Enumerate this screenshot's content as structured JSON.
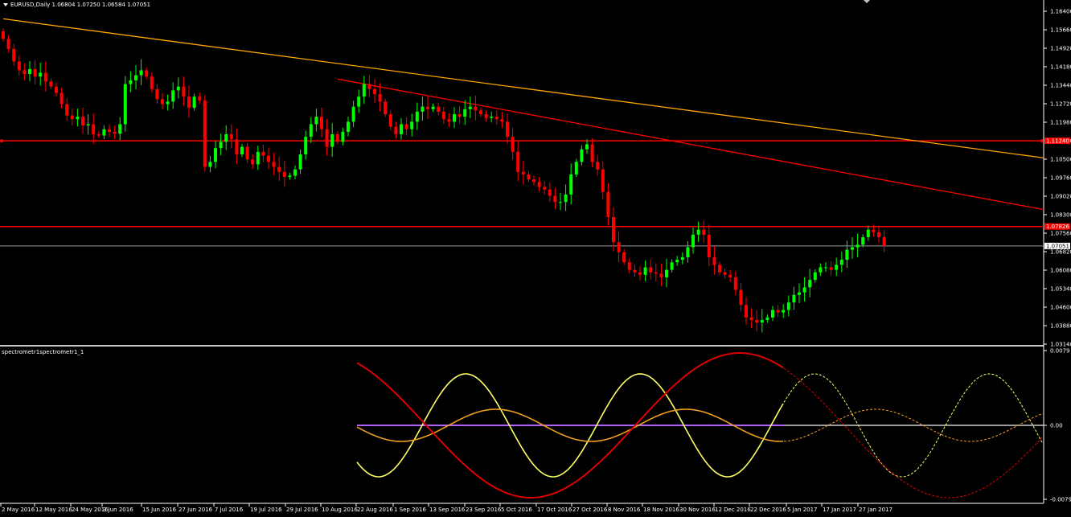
{
  "header": {
    "symbol": "EURUSD,Daily",
    "open": "1.06804",
    "high": "1.07250",
    "low": "1.06584",
    "close": "1.07051"
  },
  "indicator": {
    "title": "spectrometr1spectrometr1_1",
    "ticks": [
      "0.0079",
      "0.00",
      "-0.0079"
    ]
  },
  "colors": {
    "background": "#000000",
    "bull": "#00ff00",
    "bear": "#ff0000",
    "orange_trend": "#ffa500",
    "red_lines": "#ff0000",
    "wave_yellow": "#ffff66",
    "wave_orange": "#f0a020",
    "wave_red": "#dd0000",
    "zero_line": "#b060ff"
  },
  "chart_data": {
    "type": "candlestick",
    "y_ticks": [
      "1.16400",
      "1.15660",
      "1.14920",
      "1.14180",
      "1.13440",
      "1.12720",
      "1.11980",
      "1.11240",
      "1.10500",
      "1.09760",
      "1.09020",
      "1.08300",
      "1.07560",
      "1.06820",
      "1.06080",
      "1.05340",
      "1.04600",
      "1.03880",
      "1.03140"
    ],
    "ylim": [
      1.0314,
      1.164
    ],
    "x_labels": [
      "2 May 2016",
      "12 May 2016",
      "24 May 2016",
      "3 Jun 2016",
      "15 Jun 2016",
      "27 Jun 2016",
      "7 Jul 2016",
      "19 Jul 2016",
      "29 Jul 2016",
      "10 Aug 2016",
      "22 Aug 2016",
      "1 Sep 2016",
      "13 Sep 2016",
      "23 Sep 2016",
      "5 Oct 2016",
      "17 Oct 2016",
      "27 Oct 2016",
      "8 Nov 2016",
      "18 Nov 2016",
      "30 Nov 2016",
      "12 Dec 2016",
      "22 Dec 2016",
      "5 Jan 2017",
      "17 Jan 2017",
      "27 Jan 2017"
    ],
    "price_tags": [
      {
        "label": "1.07051",
        "value": 1.07051,
        "style": "current"
      },
      {
        "label": "1.07826",
        "value": 1.07826,
        "style": "level"
      },
      {
        "label": "1.11240",
        "value": 1.1124,
        "style": "level"
      }
    ],
    "horizontal_levels": [
      1.1124,
      1.07826,
      1.07051
    ],
    "trendlines": [
      {
        "color": "orange",
        "from": {
          "bar": 0,
          "price": 1.161
        },
        "to": {
          "bar": 194,
          "price": 1.1056
        }
      },
      {
        "color": "red",
        "from": {
          "bar": 63,
          "price": 1.137
        },
        "to": {
          "bar": 194,
          "price": 1.085
        }
      }
    ],
    "closes": [
      1.153,
      1.149,
      1.144,
      1.1405,
      1.139,
      1.141,
      1.138,
      1.1395,
      1.136,
      1.134,
      1.1315,
      1.127,
      1.1225,
      1.121,
      1.122,
      1.1185,
      1.119,
      1.115,
      1.1145,
      1.117,
      1.116,
      1.1152,
      1.119,
      1.135,
      1.1365,
      1.1385,
      1.1405,
      1.138,
      1.133,
      1.129,
      1.127,
      1.128,
      1.1325,
      1.134,
      1.13,
      1.1255,
      1.13,
      1.1285,
      1.102,
      1.104,
      1.1095,
      1.112,
      1.115,
      1.113,
      1.107,
      1.11,
      1.105,
      1.103,
      1.108,
      1.1065,
      1.104,
      1.102,
      1.1,
      1.098,
      1.0985,
      1.101,
      1.107,
      1.114,
      1.119,
      1.122,
      1.117,
      1.11,
      1.115,
      1.112,
      1.116,
      1.12,
      1.126,
      1.13,
      1.135,
      1.133,
      1.131,
      1.128,
      1.123,
      1.118,
      1.115,
      1.119,
      1.117,
      1.12,
      1.124,
      1.126,
      1.125,
      1.126,
      1.124,
      1.121,
      1.12,
      1.123,
      1.122,
      1.125,
      1.126,
      1.1245,
      1.123,
      1.1215,
      1.122,
      1.121,
      1.12,
      1.114,
      1.108,
      1.1,
      1.099,
      1.097,
      1.096,
      1.094,
      1.093,
      1.0905,
      1.088,
      1.088,
      1.091,
      1.099,
      1.104,
      1.109,
      1.111,
      1.104,
      1.101,
      1.092,
      1.082,
      1.072,
      1.068,
      1.064,
      1.061,
      1.06,
      1.059,
      1.062,
      1.06,
      1.0595,
      1.058,
      1.061,
      1.064,
      1.065,
      1.066,
      1.07,
      1.075,
      1.077,
      1.075,
      1.066,
      1.063,
      1.06,
      1.059,
      1.058,
      1.053,
      1.047,
      1.042,
      1.041,
      1.04,
      1.041,
      1.042,
      1.045,
      1.044,
      1.045,
      1.048,
      1.051,
      1.052,
      1.054,
      1.057,
      1.06,
      1.062,
      1.062,
      1.061,
      1.063,
      1.065,
      1.069,
      1.07,
      1.071,
      1.074,
      1.077,
      1.076,
      1.074,
      1.0705
    ]
  }
}
